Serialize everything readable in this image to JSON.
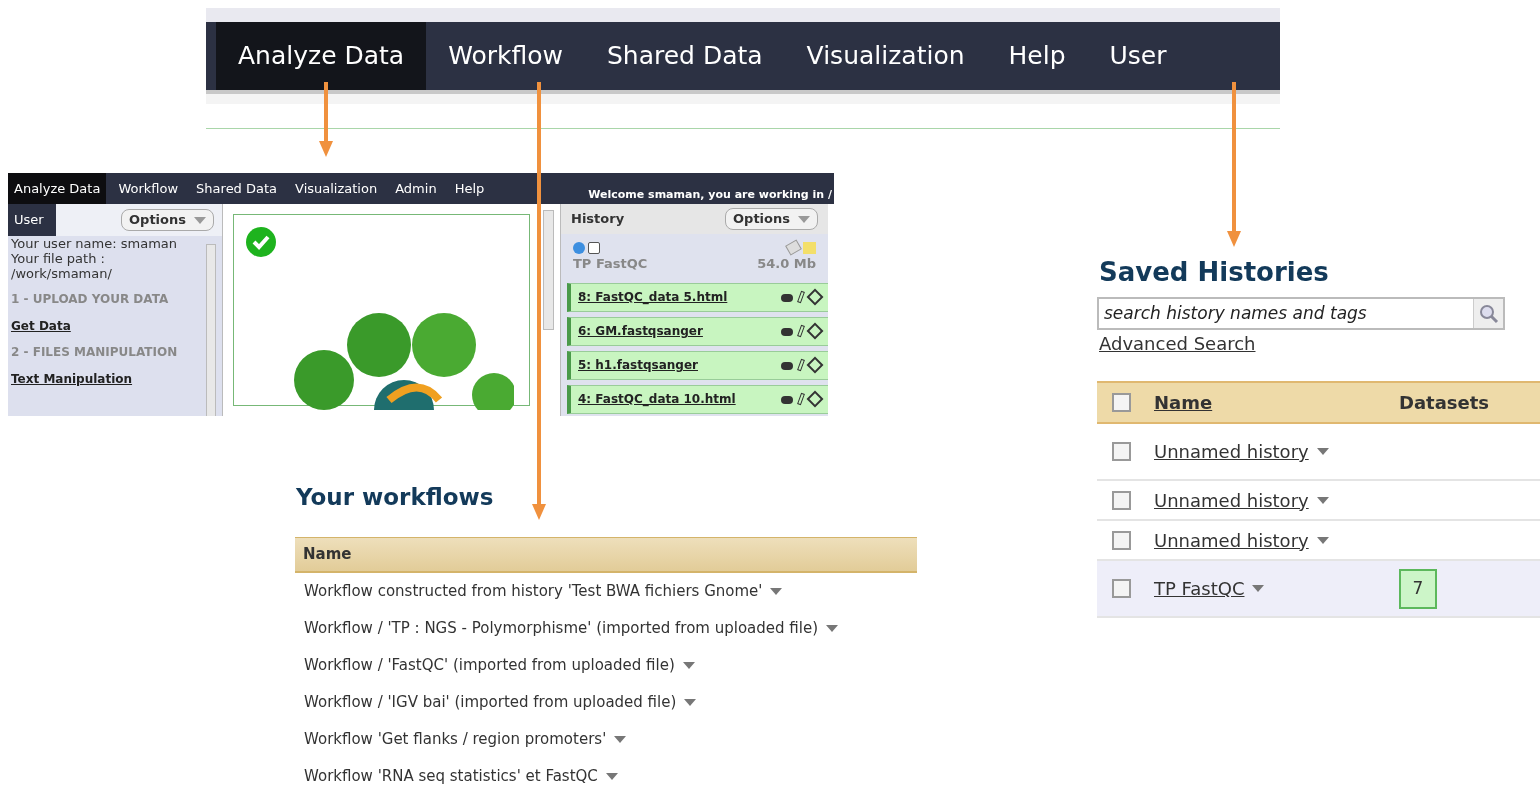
{
  "top_nav": {
    "tabs": [
      {
        "label": "Analyze Data",
        "selected": true
      },
      {
        "label": "Workflow",
        "selected": false
      },
      {
        "label": "Shared Data",
        "selected": false
      },
      {
        "label": "Visualization",
        "selected": false
      },
      {
        "label": "Help",
        "selected": false
      },
      {
        "label": "User",
        "selected": false
      }
    ]
  },
  "galaxy_window": {
    "tabs": [
      {
        "label": "Analyze Data",
        "selected": true
      },
      {
        "label": "Workflow",
        "selected": false
      },
      {
        "label": "Shared Data",
        "selected": false
      },
      {
        "label": "Visualization",
        "selected": false
      },
      {
        "label": "Admin",
        "selected": false
      },
      {
        "label": "Help",
        "selected": false
      }
    ],
    "welcome": "Welcome smaman, you are working in /",
    "tool_panel": {
      "tab": "User",
      "options": "Options",
      "info": [
        "Your user name: smaman",
        "Your file path :",
        "/work/smaman/"
      ],
      "sections": [
        {
          "kind": "heading",
          "text": "1 - UPLOAD YOUR DATA"
        },
        {
          "kind": "link",
          "text": "Get Data"
        },
        {
          "kind": "heading",
          "text": "2 - FILES MANIPULATION"
        },
        {
          "kind": "link",
          "text": "Text Manipulation"
        }
      ]
    },
    "history": {
      "title": "History",
      "options": "Options",
      "name": "TP FastQC",
      "size": "54.0 Mb",
      "items": [
        "8: FastQC_data 5.html",
        "6: GM.fastqsanger",
        "5: h1.fastqsanger",
        "4: FastQC_data 10.html"
      ]
    }
  },
  "workflows": {
    "title": "Your workflows",
    "column": "Name",
    "rows": [
      "Workflow constructed from history 'Test BWA fichiers Gnome'",
      "Workflow / 'TP : NGS - Polymorphisme' (imported from uploaded file)",
      "Workflow / 'FastQC' (imported from uploaded file)",
      "Workflow / 'IGV bai' (imported from uploaded file)",
      "Workflow 'Get flanks / region promoters'",
      "Workflow 'RNA seq statistics' et FastQC"
    ]
  },
  "saved_histories": {
    "title": "Saved Histories",
    "search": {
      "placeholder": "search history names and tags"
    },
    "advanced_search": "Advanced Search",
    "columns": {
      "name": "Name",
      "datasets": "Datasets"
    },
    "header_checked": false,
    "rows": [
      {
        "name": "Unnamed history",
        "checked": false,
        "selected": false
      },
      {
        "name": "Unnamed history",
        "checked": false,
        "selected": false
      },
      {
        "name": "Unnamed history",
        "checked": false,
        "selected": false
      },
      {
        "name": "TP FastQC",
        "datasets": "7",
        "checked": false,
        "selected": true
      }
    ]
  }
}
